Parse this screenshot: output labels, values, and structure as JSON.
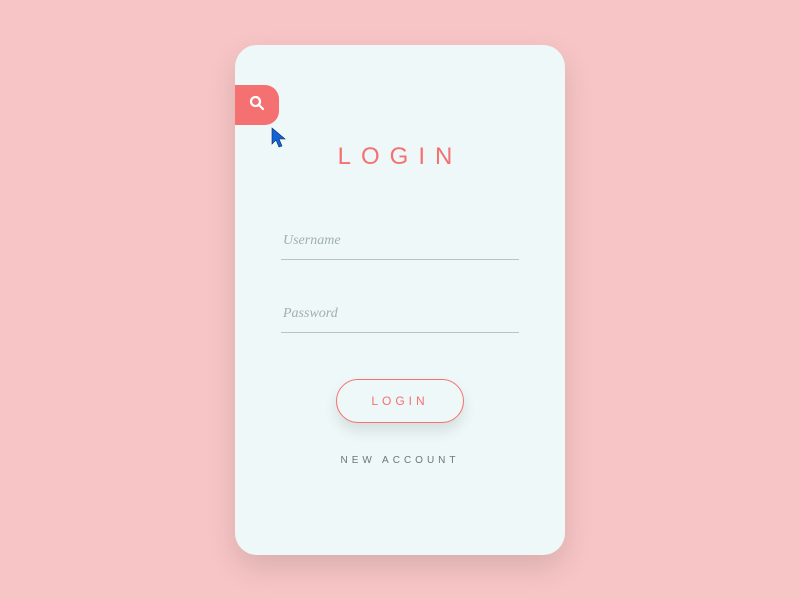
{
  "header": {
    "title": "LOGIN"
  },
  "fields": {
    "username": {
      "placeholder": "Username",
      "value": ""
    },
    "password": {
      "placeholder": "Password",
      "value": ""
    }
  },
  "buttons": {
    "login_label": "LOGIN",
    "new_account_label": "NEW ACCOUNT"
  },
  "icons": {
    "search": "search-icon"
  },
  "colors": {
    "accent": "#f57070",
    "card": "#eef8f8",
    "bg": "#f7c5c5"
  }
}
